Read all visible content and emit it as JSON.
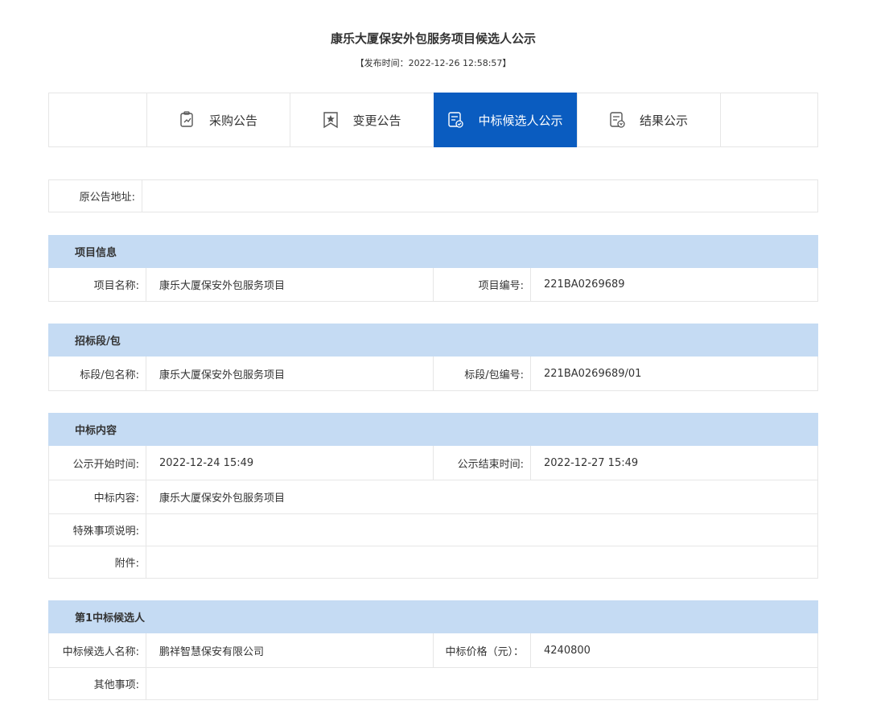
{
  "header": {
    "title": "康乐大厦保安外包服务项目候选人公示",
    "pub_time": "【发布时间：2022-12-26 12:58:57】"
  },
  "tabs": [
    {
      "label": "采购公告",
      "icon": "document-edit-icon"
    },
    {
      "label": "变更公告",
      "icon": "bookmark-star-icon"
    },
    {
      "label": "中标候选人公示",
      "icon": "document-check-icon",
      "active": true
    },
    {
      "label": "结果公示",
      "icon": "document-seal-icon"
    }
  ],
  "original": {
    "label": "原公告地址:",
    "value": ""
  },
  "project": {
    "heading": "项目信息",
    "name_label": "项目名称:",
    "name_value": "康乐大厦保安外包服务项目",
    "code_label": "项目编号:",
    "code_value": "221BA0269689"
  },
  "section": {
    "heading": "招标段/包",
    "name_label": "标段/包名称:",
    "name_value": "康乐大厦保安外包服务项目",
    "code_label": "标段/包编号:",
    "code_value": "221BA0269689/01"
  },
  "award": {
    "heading": "中标内容",
    "start_label": "公示开始时间:",
    "start_value": "2022-12-24 15:49",
    "end_label": "公示结束时间:",
    "end_value": "2022-12-27 15:49",
    "content_label": "中标内容:",
    "content_value": "康乐大厦保安外包服务项目",
    "special_label": "特殊事项说明:",
    "special_value": "",
    "attach_label": "附件:",
    "attach_value": ""
  },
  "candidate": {
    "heading": "第1中标候选人",
    "name_label": "中标候选人名称:",
    "name_value": "鹏祥智慧保安有限公司",
    "price_label": "中标价格（元）：",
    "price_value": "4240800",
    "other_label": "其他事项:",
    "other_value": ""
  }
}
